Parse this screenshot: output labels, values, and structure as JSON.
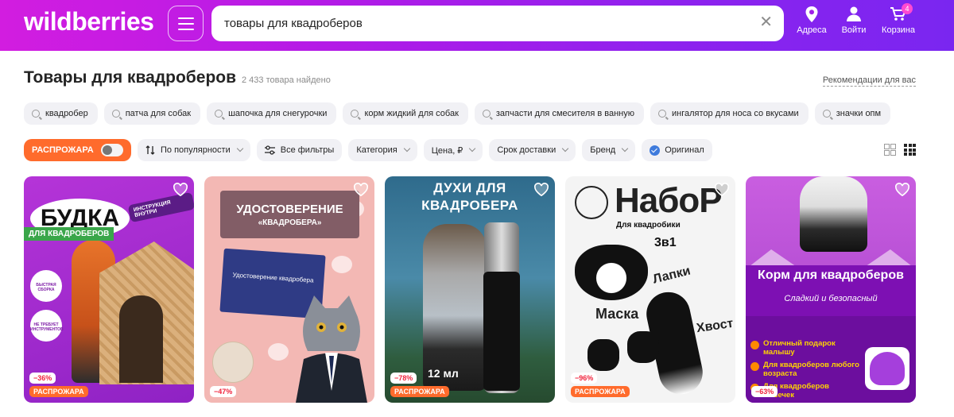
{
  "header": {
    "logo": "wildberries",
    "search_value": "товары для квадроберов",
    "addresses_label": "Адреса",
    "login_label": "Войти",
    "cart_label": "Корзина",
    "cart_count": "4",
    "gradient_start": "#d21de0",
    "gradient_end": "#7a26f0"
  },
  "page": {
    "title": "Товары для квадроберов",
    "found": "2 433 товара найдено",
    "recommendations": "Рекомендации для вас"
  },
  "suggestions": [
    "квадробер",
    "патча для собак",
    "шапочка для снегурочки",
    "корм жидкий для собак",
    "запчасти для смесителя в ванную",
    "ингалятор для носа со вкусами",
    "значки опм"
  ],
  "filters": {
    "sale": "РАСПРОЖАРА",
    "sort": "По популярности",
    "all_filters": "Все фильтры",
    "category": "Категория",
    "price": "Цена, ₽",
    "delivery": "Срок доставки",
    "brand": "Бренд",
    "original": "Оригинал"
  },
  "accent_colors": {
    "sale": "#ff6b2c",
    "discount": "#f0233c",
    "original": "#3f7bdc"
  },
  "cards": [
    {
      "discount": "−36%",
      "badge": "РАСПРОЖАРА",
      "texts": {
        "title": "БУДКА",
        "subtitle": "ДЛЯ КВАДРОБЕРОВ",
        "tag": "ИНСТРУКЦИЯ ВНУТРИ",
        "feature1": "БЫСТРАЯ СБОРКА",
        "feature2": "НЕ ТРЕБУЕТ ИНСТРУМЕНТОВ"
      }
    },
    {
      "discount": "−47%",
      "badge": "",
      "texts": {
        "title": "УДОСТОВЕРЕНИЕ",
        "subtitle": "«КВАДРОБЕРА»",
        "doc": "Удостоверение квадробера"
      }
    },
    {
      "discount": "−78%",
      "badge": "РАСПРОЖАРА",
      "texts": {
        "title": "ДУХИ ДЛЯ КВАДРОБЕРА",
        "volume": "12 мл"
      }
    },
    {
      "discount": "−96%",
      "badge": "РАСПРОЖАРА",
      "texts": {
        "title": "НабоР",
        "subtitle": "Для квадробики",
        "set": "3в1",
        "mask": "Маска",
        "paws": "Лапки",
        "tail": "Хвост"
      }
    },
    {
      "discount": "−63%",
      "badge": "",
      "texts": {
        "title": "Корм для квадроберов",
        "subtitle": "Сладкий и безопасный",
        "b1": "Отличный подарок малышу",
        "b2": "Для квадроберов любого возраста",
        "b3": "Для квадроберов кошечек"
      }
    }
  ]
}
